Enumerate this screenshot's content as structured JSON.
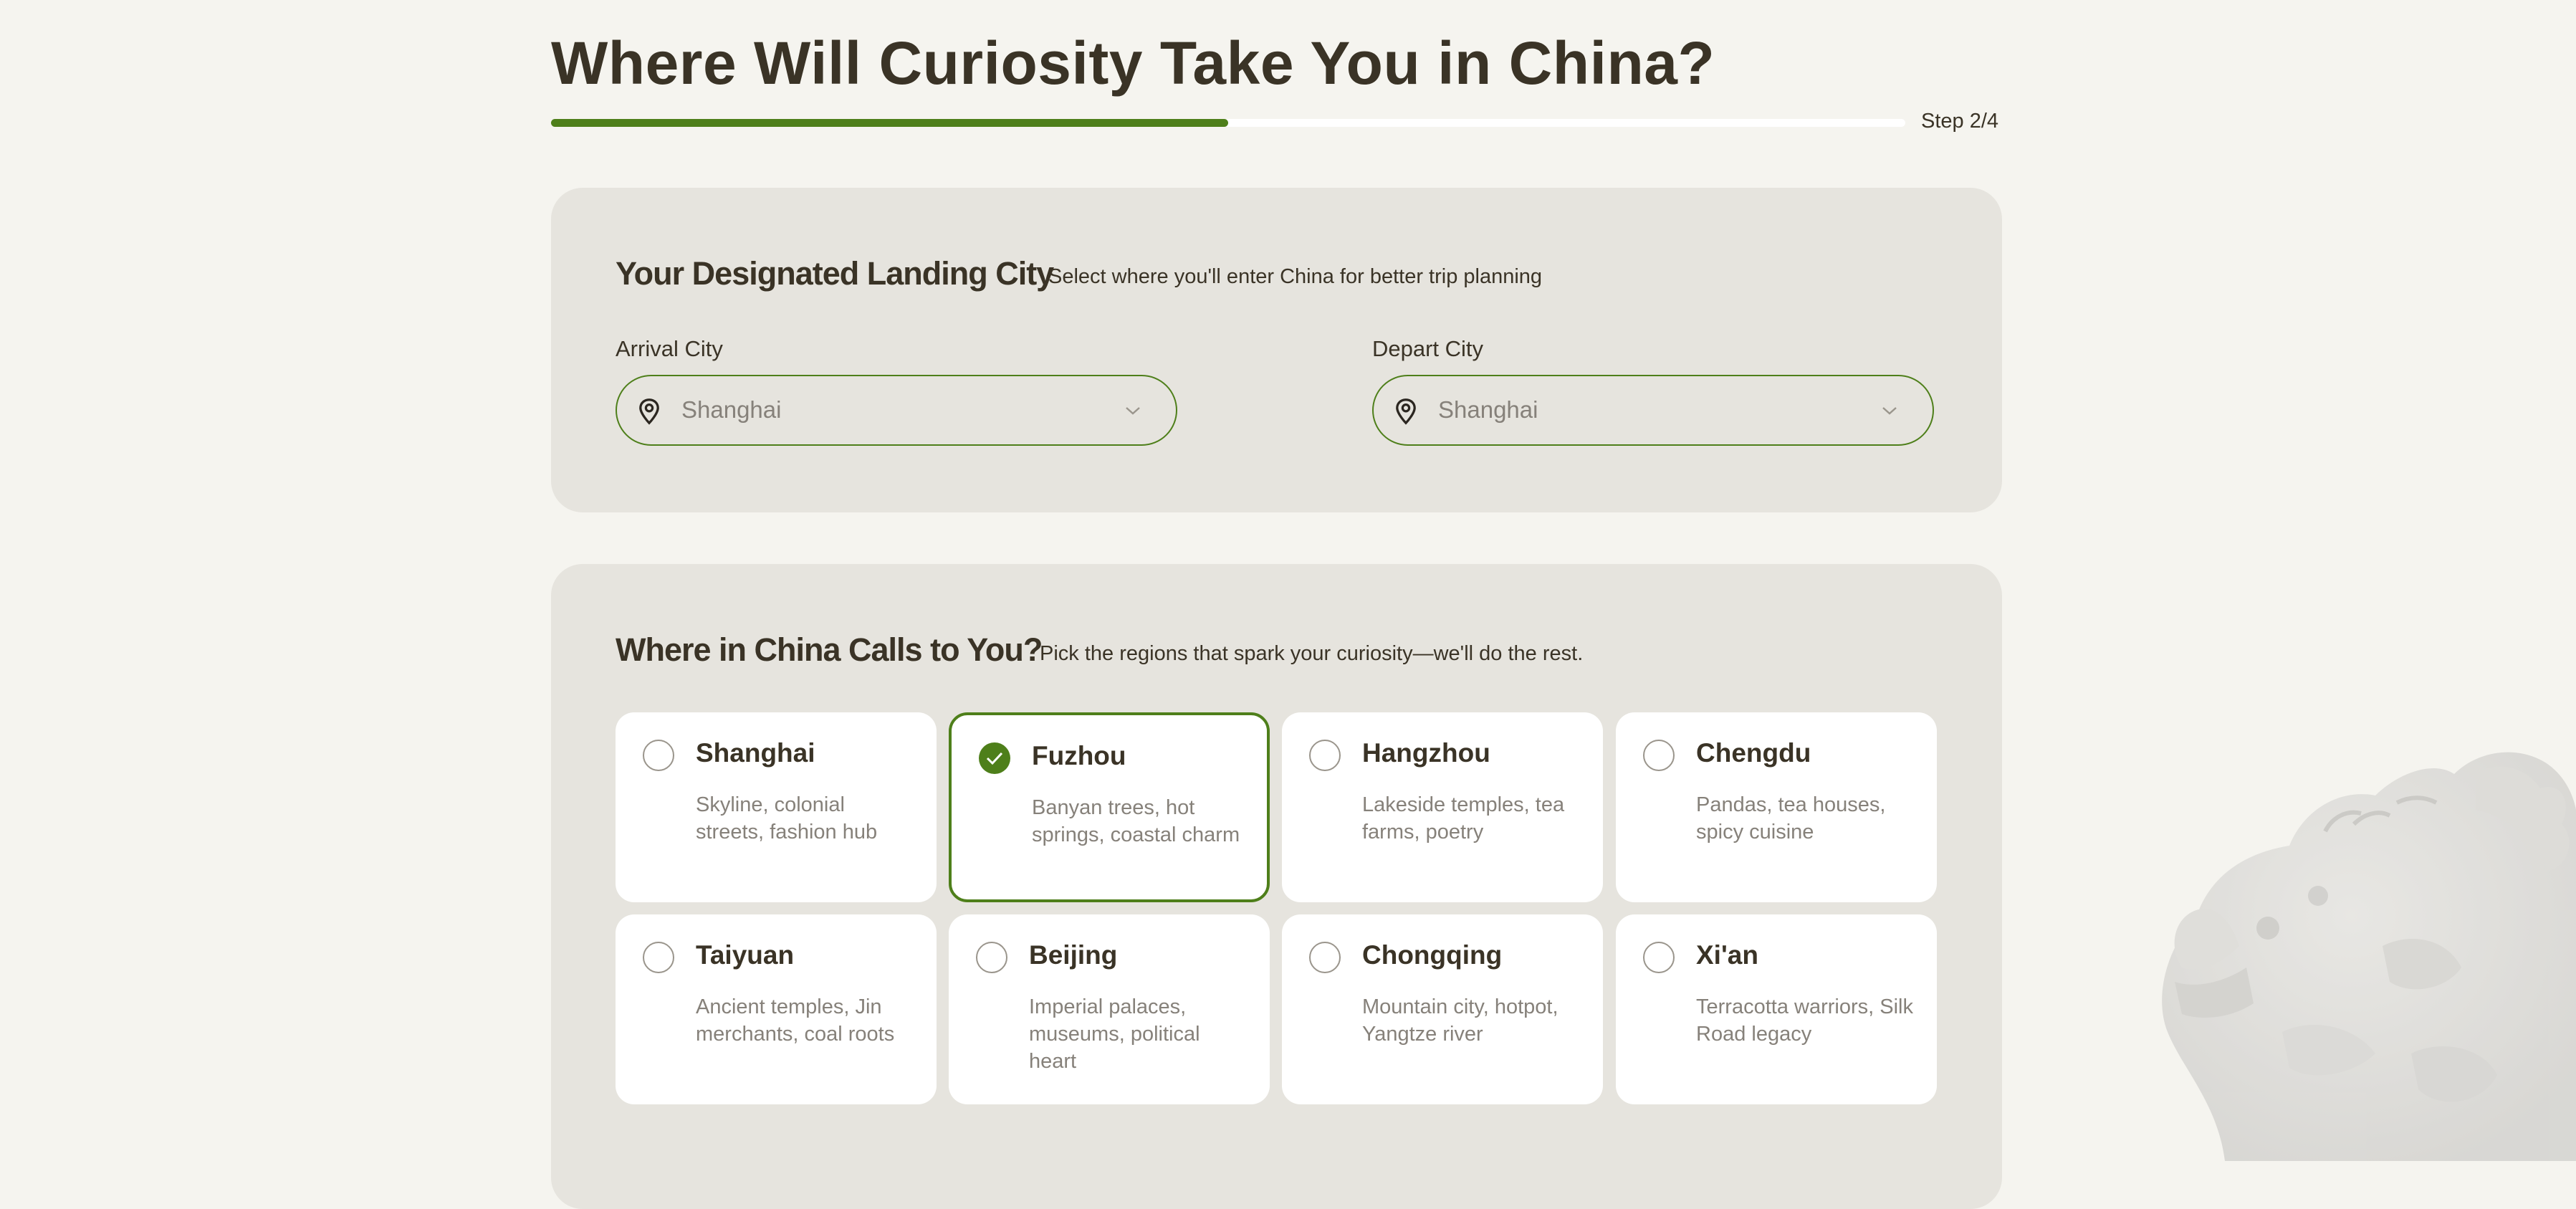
{
  "header": {
    "title": "Where Will Curiosity Take You in China?",
    "step_label": "Step 2/4",
    "progress_fraction": 0.5
  },
  "landing": {
    "title": "Your Designated Landing City",
    "subtitle": "Select where you'll enter China for better trip planning",
    "arrival": {
      "label": "Arrival City",
      "value": "Shanghai",
      "icon": "map-pin-icon"
    },
    "depart": {
      "label": "Depart City",
      "value": "Shanghai",
      "icon": "map-pin-icon"
    }
  },
  "regions": {
    "title": "Where in China Calls to You?",
    "subtitle": "Pick the regions that spark your curiosity—we'll do the rest.",
    "items": [
      {
        "name": "Shanghai",
        "desc": "Skyline, colonial streets, fashion hub",
        "selected": false
      },
      {
        "name": "Fuzhou",
        "desc": "Banyan trees, hot springs, coastal charm",
        "selected": true
      },
      {
        "name": "Hangzhou",
        "desc": "Lakeside temples, tea farms, poetry",
        "selected": false
      },
      {
        "name": "Chengdu",
        "desc": "Pandas, tea houses, spicy cuisine",
        "selected": false
      },
      {
        "name": "Taiyuan",
        "desc": "Ancient temples, Jin merchants, coal roots",
        "selected": false
      },
      {
        "name": "Beijing",
        "desc": "Imperial palaces, museums, political heart",
        "selected": false
      },
      {
        "name": "Chongqing",
        "desc": "Mountain city, hotpot, Yangtze river",
        "selected": false
      },
      {
        "name": "Xi'an",
        "desc": "Terracotta warriors, Silk Road legacy",
        "selected": false
      }
    ]
  },
  "colors": {
    "accent": "#4e7f1a",
    "background": "#f5f4ef",
    "card": "#e6e4de",
    "text": "#3a3326",
    "muted": "#86817a"
  }
}
